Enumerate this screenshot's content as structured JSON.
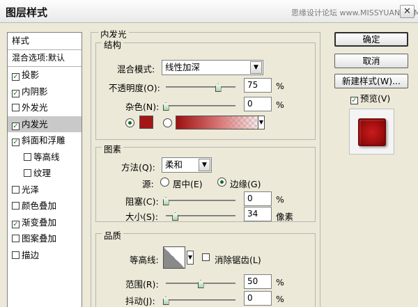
{
  "window": {
    "title": "图层样式",
    "watermark": "思缘设计论坛 www.MISSYUAN.COM",
    "close": "✕"
  },
  "style_list": {
    "header": "样式",
    "blend_options": "混合选项:默认",
    "items": [
      {
        "label": "投影",
        "checked": true
      },
      {
        "label": "内阴影",
        "checked": true
      },
      {
        "label": "外发光",
        "checked": false
      },
      {
        "label": "内发光",
        "checked": true,
        "selected": true
      },
      {
        "label": "斜面和浮雕",
        "checked": true
      },
      {
        "label": "等高线",
        "checked": false,
        "sub": true
      },
      {
        "label": "纹理",
        "checked": false,
        "sub": true
      },
      {
        "label": "光泽",
        "checked": false
      },
      {
        "label": "颜色叠加",
        "checked": false
      },
      {
        "label": "渐变叠加",
        "checked": true
      },
      {
        "label": "图案叠加",
        "checked": false
      },
      {
        "label": "描边",
        "checked": false
      }
    ]
  },
  "panel": {
    "title": "内发光",
    "structure": {
      "legend": "结构",
      "blend_mode_label": "混合模式:",
      "blend_mode_value": "线性加深",
      "opacity_label": "不透明度(O):",
      "opacity_value": "75",
      "opacity_pct": 75,
      "noise_label": "杂色(N):",
      "noise_value": "0",
      "noise_pct": 0,
      "unit": "%",
      "color_mode": "solid",
      "glow_color": "#a51717"
    },
    "elements": {
      "legend": "图素",
      "technique_label": "方法(Q):",
      "technique_value": "柔和",
      "source_label": "源:",
      "source_center": "居中(E)",
      "source_edge": "边缘(G)",
      "source_selected": "edge",
      "choke_label": "阻塞(C):",
      "choke_value": "0",
      "choke_pct": 0,
      "size_label": "大小(S):",
      "size_value": "34",
      "size_frac": 0.136,
      "unit_pct": "%",
      "unit_px": "像素"
    },
    "quality": {
      "legend": "品质",
      "contour_label": "等高线:",
      "antialias_label": "消除锯齿(L)",
      "antialias_checked": false,
      "range_label": "范围(R):",
      "range_value": "50",
      "range_pct": 50,
      "jitter_label": "抖动(J):",
      "jitter_value": "0",
      "jitter_pct": 0,
      "unit": "%"
    }
  },
  "buttons": {
    "ok": "确定",
    "cancel": "取消",
    "new_style": "新建样式(W)...",
    "preview_label": "预览(V)",
    "preview_checked": true
  },
  "colors": {
    "accent_red": "#a51717",
    "check_green": "#1a7a1a"
  }
}
